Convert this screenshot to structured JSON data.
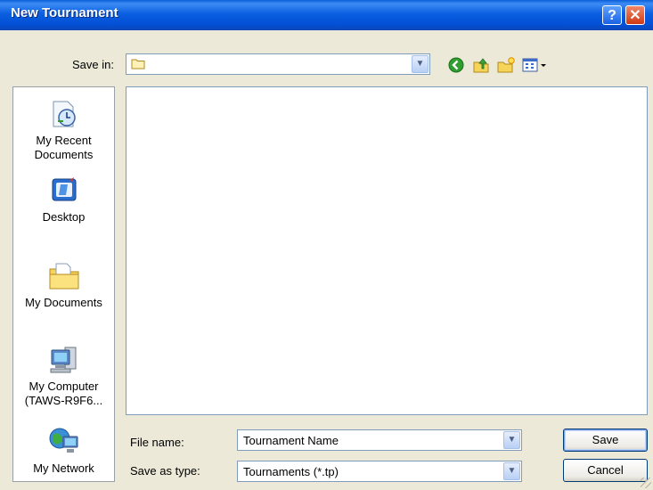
{
  "window": {
    "title": "New Tournament",
    "help_icon": "question-icon",
    "close_icon": "close-icon"
  },
  "save_in": {
    "label": "Save in:",
    "value": "",
    "toolbar": [
      "back-icon",
      "up-folder-icon",
      "new-folder-icon",
      "views-menu-icon"
    ]
  },
  "places": [
    {
      "label": "My Recent Documents",
      "icon": "recent-documents-icon"
    },
    {
      "label": "Desktop",
      "icon": "desktop-icon"
    },
    {
      "label": "My Documents",
      "icon": "my-documents-icon"
    },
    {
      "label": "My Computer (TAWS-R9F6...",
      "icon": "my-computer-icon"
    },
    {
      "label": "My Network",
      "icon": "my-network-icon"
    }
  ],
  "file_name": {
    "label": "File name:",
    "value": "Tournament Name"
  },
  "save_as_type": {
    "label": "Save as type:",
    "value": "Tournaments (*.tp)"
  },
  "buttons": {
    "save": "Save",
    "cancel": "Cancel"
  },
  "colors": {
    "titlebar": "#0350d6",
    "dialog_bg": "#ece9d8",
    "field_border": "#7f9db9"
  }
}
